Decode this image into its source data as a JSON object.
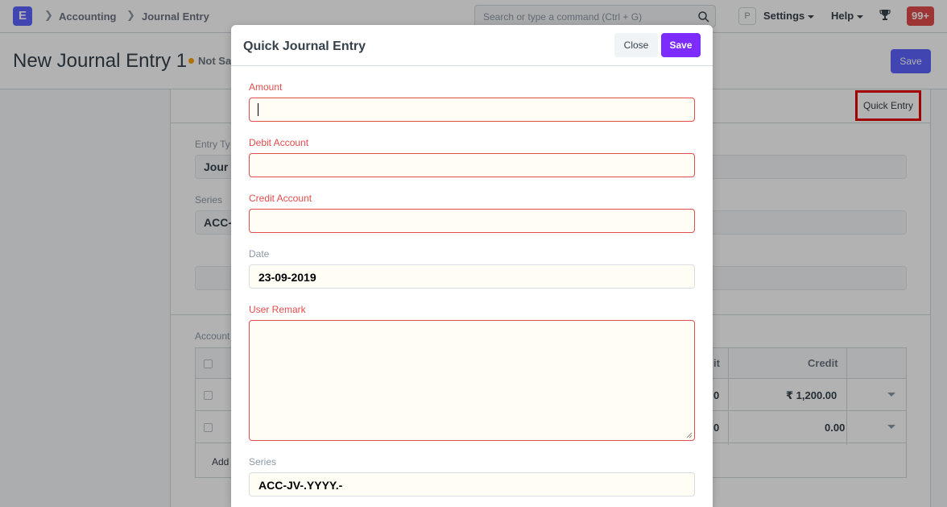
{
  "navbar": {
    "logo": "E",
    "breadcrumbs": [
      "Accounting",
      "Journal Entry"
    ],
    "search_placeholder": "Search or type a command (Ctrl + G)",
    "avatar_initial": "P",
    "settings_label": "Settings",
    "help_label": "Help",
    "notification_count": "99+"
  },
  "page": {
    "title": "New Journal Entry 1",
    "status": "Not Sa",
    "save_label": "Save"
  },
  "form": {
    "quick_entry_label": "Quick Entry",
    "entry_type_label": "Entry Ty",
    "entry_type_value": "Jour",
    "series_label": "Series",
    "series_value": "ACC-",
    "accounts_label": "Account",
    "grid": {
      "debit_header_fragment": "it",
      "credit_header": "Credit",
      "rows": [
        {
          "debit_fragment": "0",
          "credit": "₹ 1,200.00"
        },
        {
          "debit_fragment": "0",
          "credit": "0.00"
        }
      ],
      "add_row_label": "Add"
    }
  },
  "modal": {
    "title": "Quick Journal Entry",
    "close_label": "Close",
    "save_label": "Save",
    "fields": {
      "amount": {
        "label": "Amount",
        "value": ""
      },
      "debit_account": {
        "label": "Debit Account",
        "value": ""
      },
      "credit_account": {
        "label": "Credit Account",
        "value": ""
      },
      "date": {
        "label": "Date",
        "value": "23-09-2019"
      },
      "user_remark": {
        "label": "User Remark",
        "value": ""
      },
      "series": {
        "label": "Series",
        "value": "ACC-JV-.YYYY.-"
      }
    }
  },
  "colors": {
    "primary": "#5e64ff",
    "modal_save": "#7c2cff",
    "required": "#e24c4c",
    "highlight_box": "#e50000",
    "status_dot": "#ffa00a"
  }
}
